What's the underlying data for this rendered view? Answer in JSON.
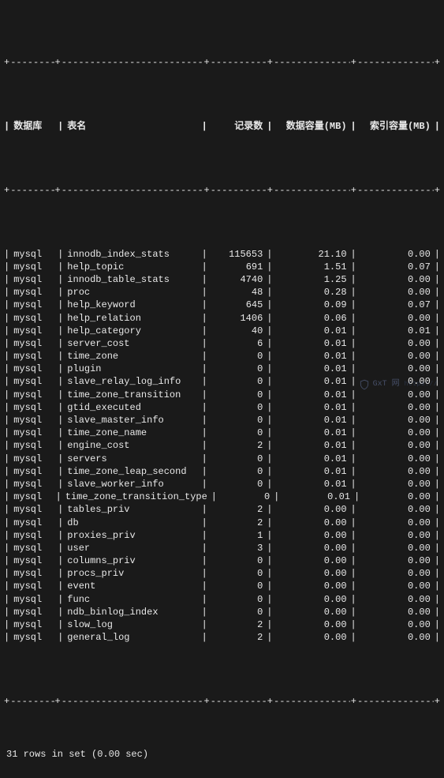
{
  "headers": {
    "db": "数据库",
    "table": "表名",
    "records": "记录数",
    "data_mb": "数据容量(MB)",
    "index_mb": "索引容量(MB)"
  },
  "rows": [
    {
      "db": "mysql",
      "table": "innodb_index_stats",
      "records": "115653",
      "data_mb": "21.10",
      "index_mb": "0.00"
    },
    {
      "db": "mysql",
      "table": "help_topic",
      "records": "691",
      "data_mb": "1.51",
      "index_mb": "0.07"
    },
    {
      "db": "mysql",
      "table": "innodb_table_stats",
      "records": "4740",
      "data_mb": "1.25",
      "index_mb": "0.00"
    },
    {
      "db": "mysql",
      "table": "proc",
      "records": "48",
      "data_mb": "0.28",
      "index_mb": "0.00"
    },
    {
      "db": "mysql",
      "table": "help_keyword",
      "records": "645",
      "data_mb": "0.09",
      "index_mb": "0.07"
    },
    {
      "db": "mysql",
      "table": "help_relation",
      "records": "1406",
      "data_mb": "0.06",
      "index_mb": "0.00"
    },
    {
      "db": "mysql",
      "table": "help_category",
      "records": "40",
      "data_mb": "0.01",
      "index_mb": "0.01"
    },
    {
      "db": "mysql",
      "table": "server_cost",
      "records": "6",
      "data_mb": "0.01",
      "index_mb": "0.00"
    },
    {
      "db": "mysql",
      "table": "time_zone",
      "records": "0",
      "data_mb": "0.01",
      "index_mb": "0.00"
    },
    {
      "db": "mysql",
      "table": "plugin",
      "records": "0",
      "data_mb": "0.01",
      "index_mb": "0.00"
    },
    {
      "db": "mysql",
      "table": "slave_relay_log_info",
      "records": "0",
      "data_mb": "0.01",
      "index_mb": "0.00"
    },
    {
      "db": "mysql",
      "table": "time_zone_transition",
      "records": "0",
      "data_mb": "0.01",
      "index_mb": "0.00"
    },
    {
      "db": "mysql",
      "table": "gtid_executed",
      "records": "0",
      "data_mb": "0.01",
      "index_mb": "0.00"
    },
    {
      "db": "mysql",
      "table": "slave_master_info",
      "records": "0",
      "data_mb": "0.01",
      "index_mb": "0.00"
    },
    {
      "db": "mysql",
      "table": "time_zone_name",
      "records": "0",
      "data_mb": "0.01",
      "index_mb": "0.00"
    },
    {
      "db": "mysql",
      "table": "engine_cost",
      "records": "2",
      "data_mb": "0.01",
      "index_mb": "0.00"
    },
    {
      "db": "mysql",
      "table": "servers",
      "records": "0",
      "data_mb": "0.01",
      "index_mb": "0.00"
    },
    {
      "db": "mysql",
      "table": "time_zone_leap_second",
      "records": "0",
      "data_mb": "0.01",
      "index_mb": "0.00"
    },
    {
      "db": "mysql",
      "table": "slave_worker_info",
      "records": "0",
      "data_mb": "0.01",
      "index_mb": "0.00"
    },
    {
      "db": "mysql",
      "table": "time_zone_transition_type",
      "records": "0",
      "data_mb": "0.01",
      "index_mb": "0.00"
    },
    {
      "db": "mysql",
      "table": "tables_priv",
      "records": "2",
      "data_mb": "0.00",
      "index_mb": "0.00"
    },
    {
      "db": "mysql",
      "table": "db",
      "records": "2",
      "data_mb": "0.00",
      "index_mb": "0.00"
    },
    {
      "db": "mysql",
      "table": "proxies_priv",
      "records": "1",
      "data_mb": "0.00",
      "index_mb": "0.00"
    },
    {
      "db": "mysql",
      "table": "user",
      "records": "3",
      "data_mb": "0.00",
      "index_mb": "0.00"
    },
    {
      "db": "mysql",
      "table": "columns_priv",
      "records": "0",
      "data_mb": "0.00",
      "index_mb": "0.00"
    },
    {
      "db": "mysql",
      "table": "procs_priv",
      "records": "0",
      "data_mb": "0.00",
      "index_mb": "0.00"
    },
    {
      "db": "mysql",
      "table": "event",
      "records": "0",
      "data_mb": "0.00",
      "index_mb": "0.00"
    },
    {
      "db": "mysql",
      "table": "func",
      "records": "0",
      "data_mb": "0.00",
      "index_mb": "0.00"
    },
    {
      "db": "mysql",
      "table": "ndb_binlog_index",
      "records": "0",
      "data_mb": "0.00",
      "index_mb": "0.00"
    },
    {
      "db": "mysql",
      "table": "slow_log",
      "records": "2",
      "data_mb": "0.00",
      "index_mb": "0.00"
    },
    {
      "db": "mysql",
      "table": "general_log",
      "records": "2",
      "data_mb": "0.00",
      "index_mb": "0.00"
    }
  ],
  "status": "31 rows in set (0.00 sec)",
  "watermark": {
    "text": "GxT 网",
    "url": "https://"
  }
}
